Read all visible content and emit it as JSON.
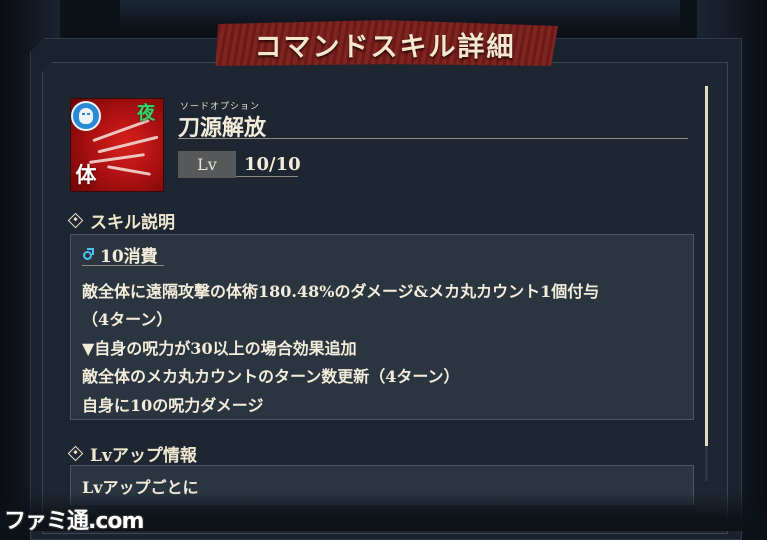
{
  "dialog": {
    "title": "コマンドスキル詳細"
  },
  "skill": {
    "ruby": "ソードオプション",
    "name": "刀源解放",
    "icon_type": "mask-icon",
    "night_glyph": "夜",
    "attribute_glyph": "体",
    "level_label": "Lv",
    "level_value": "10/10"
  },
  "description": {
    "heading": "スキル説明",
    "cost": "10消費",
    "lines": [
      "敵全体に遠隔攻撃の体術180.48%のダメージ&メカ丸カウント1個付与",
      "（4ターン）",
      "▼自身の呪力が30以上の場合効果追加",
      "敵全体のメカ丸カウントのターン数更新（4ターン）",
      "自身に10の呪力ダメージ"
    ]
  },
  "level_up": {
    "heading": "Lvアップ情報",
    "first_line": "Lvアップごとに"
  },
  "watermark": "ファミ通.com",
  "colors": {
    "banner": "#7a1d1a",
    "panel": "#1e2731",
    "text": "#f3ecda",
    "accent_blue": "#2a8ad6",
    "accent_green": "#38d26a",
    "icon_red": "#d8201c"
  }
}
